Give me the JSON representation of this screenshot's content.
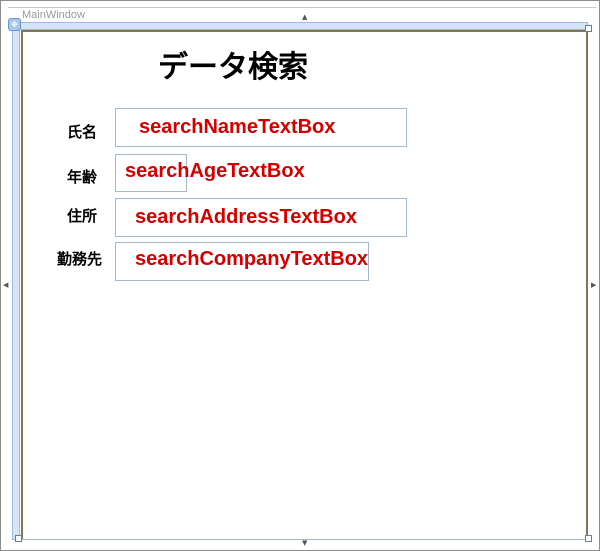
{
  "window": {
    "title": "MainWindow"
  },
  "form": {
    "heading": "データ検索",
    "fields": [
      {
        "label": "氏名",
        "annotation": "searchNameTextBox",
        "value": ""
      },
      {
        "label": "年齢",
        "annotation": "searchAgeTextBox",
        "value": ""
      },
      {
        "label": "住所",
        "annotation": "searchAddressTextBox",
        "value": ""
      },
      {
        "label": "勤務先",
        "annotation": "searchCompanyTextBox",
        "value": ""
      }
    ]
  },
  "colors": {
    "annotation": "#d40000",
    "frame_bar": "#d6e4f5",
    "window_border": "#8b7355"
  }
}
